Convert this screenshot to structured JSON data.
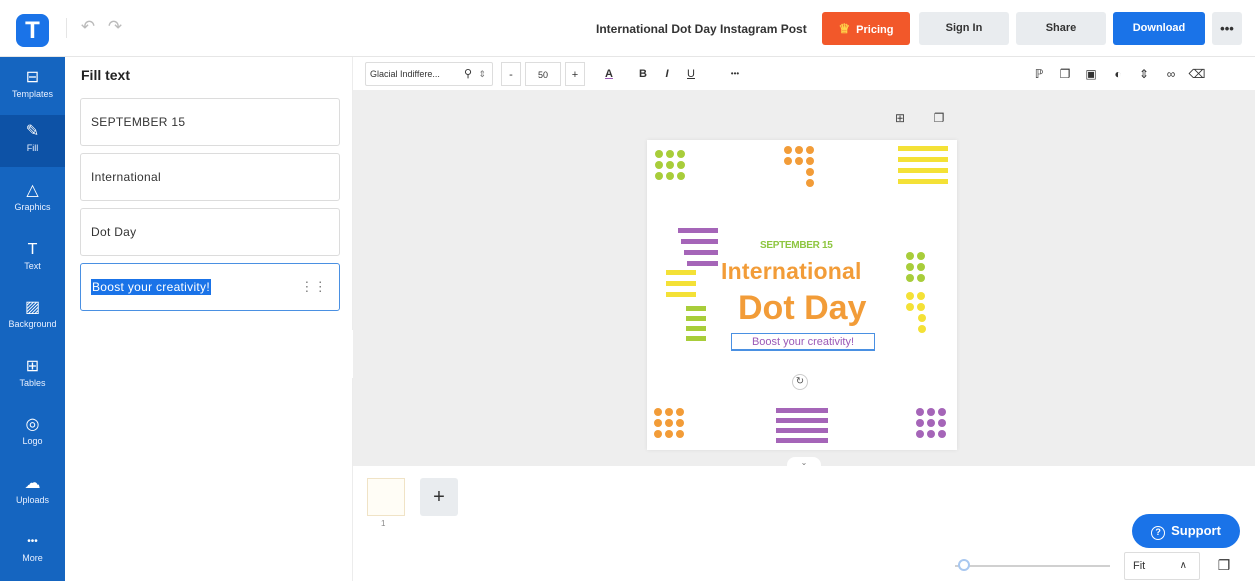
{
  "app": {
    "logo_letter": "T",
    "undo_icon": "undo-icon",
    "redo_icon": "redo-icon",
    "doc_title": "International Dot Day Instagram Post",
    "buttons": {
      "pricing": "Pricing",
      "signin": "Sign In",
      "share": "Share",
      "download": "Download",
      "more": "•••"
    },
    "brand_color": "#1a73e8",
    "pricing_color": "#f2582a"
  },
  "rail": {
    "items": [
      {
        "label": "Templates",
        "icon": "templates-icon",
        "glyph": "⊟"
      },
      {
        "label": "Fill",
        "icon": "pencil-icon",
        "glyph": "✎"
      },
      {
        "label": "Graphics",
        "icon": "shapes-icon",
        "glyph": "△"
      },
      {
        "label": "Text",
        "icon": "text-icon",
        "glyph": "T"
      },
      {
        "label": "Background",
        "icon": "background-icon",
        "glyph": "▨"
      },
      {
        "label": "Tables",
        "icon": "table-icon",
        "glyph": "⊞"
      },
      {
        "label": "Logo",
        "icon": "logo-icon",
        "glyph": "◎"
      },
      {
        "label": "Uploads",
        "icon": "upload-icon",
        "glyph": "☁"
      },
      {
        "label": "More",
        "icon": "more-icon",
        "glyph": "•••"
      }
    ]
  },
  "panel": {
    "title": "Fill text",
    "fields": [
      {
        "value": "SEPTEMBER 15"
      },
      {
        "value": "International"
      },
      {
        "value": "Dot Day"
      },
      {
        "value": "Boost your creativity!"
      }
    ],
    "collapse": "‹"
  },
  "toolbar": {
    "font": "Glacial Indiffere...",
    "font_size": "50",
    "minus": "-",
    "plus": "+",
    "A": "A",
    "B": "B",
    "I": "I",
    "U": "U",
    "more": "•••",
    "right_icons": [
      "format-paint-icon",
      "copy-icon",
      "layer-icon",
      "opacity-icon",
      "position-icon",
      "link-icon",
      "delete-icon"
    ]
  },
  "canvas": {
    "date": "SEPTEMBER 15",
    "line1": "International",
    "line2": "Dot Day",
    "tagline": "Boost your creativity!",
    "colors": {
      "orange": "#f29c38",
      "green": "#a8cd3a",
      "purple": "#a565b8",
      "yellow": "#f4e136"
    }
  },
  "footer": {
    "page_number": "1",
    "add_page": "+",
    "zoom_mode": "Fit",
    "zoom_caret": "∧",
    "support": "Support"
  }
}
